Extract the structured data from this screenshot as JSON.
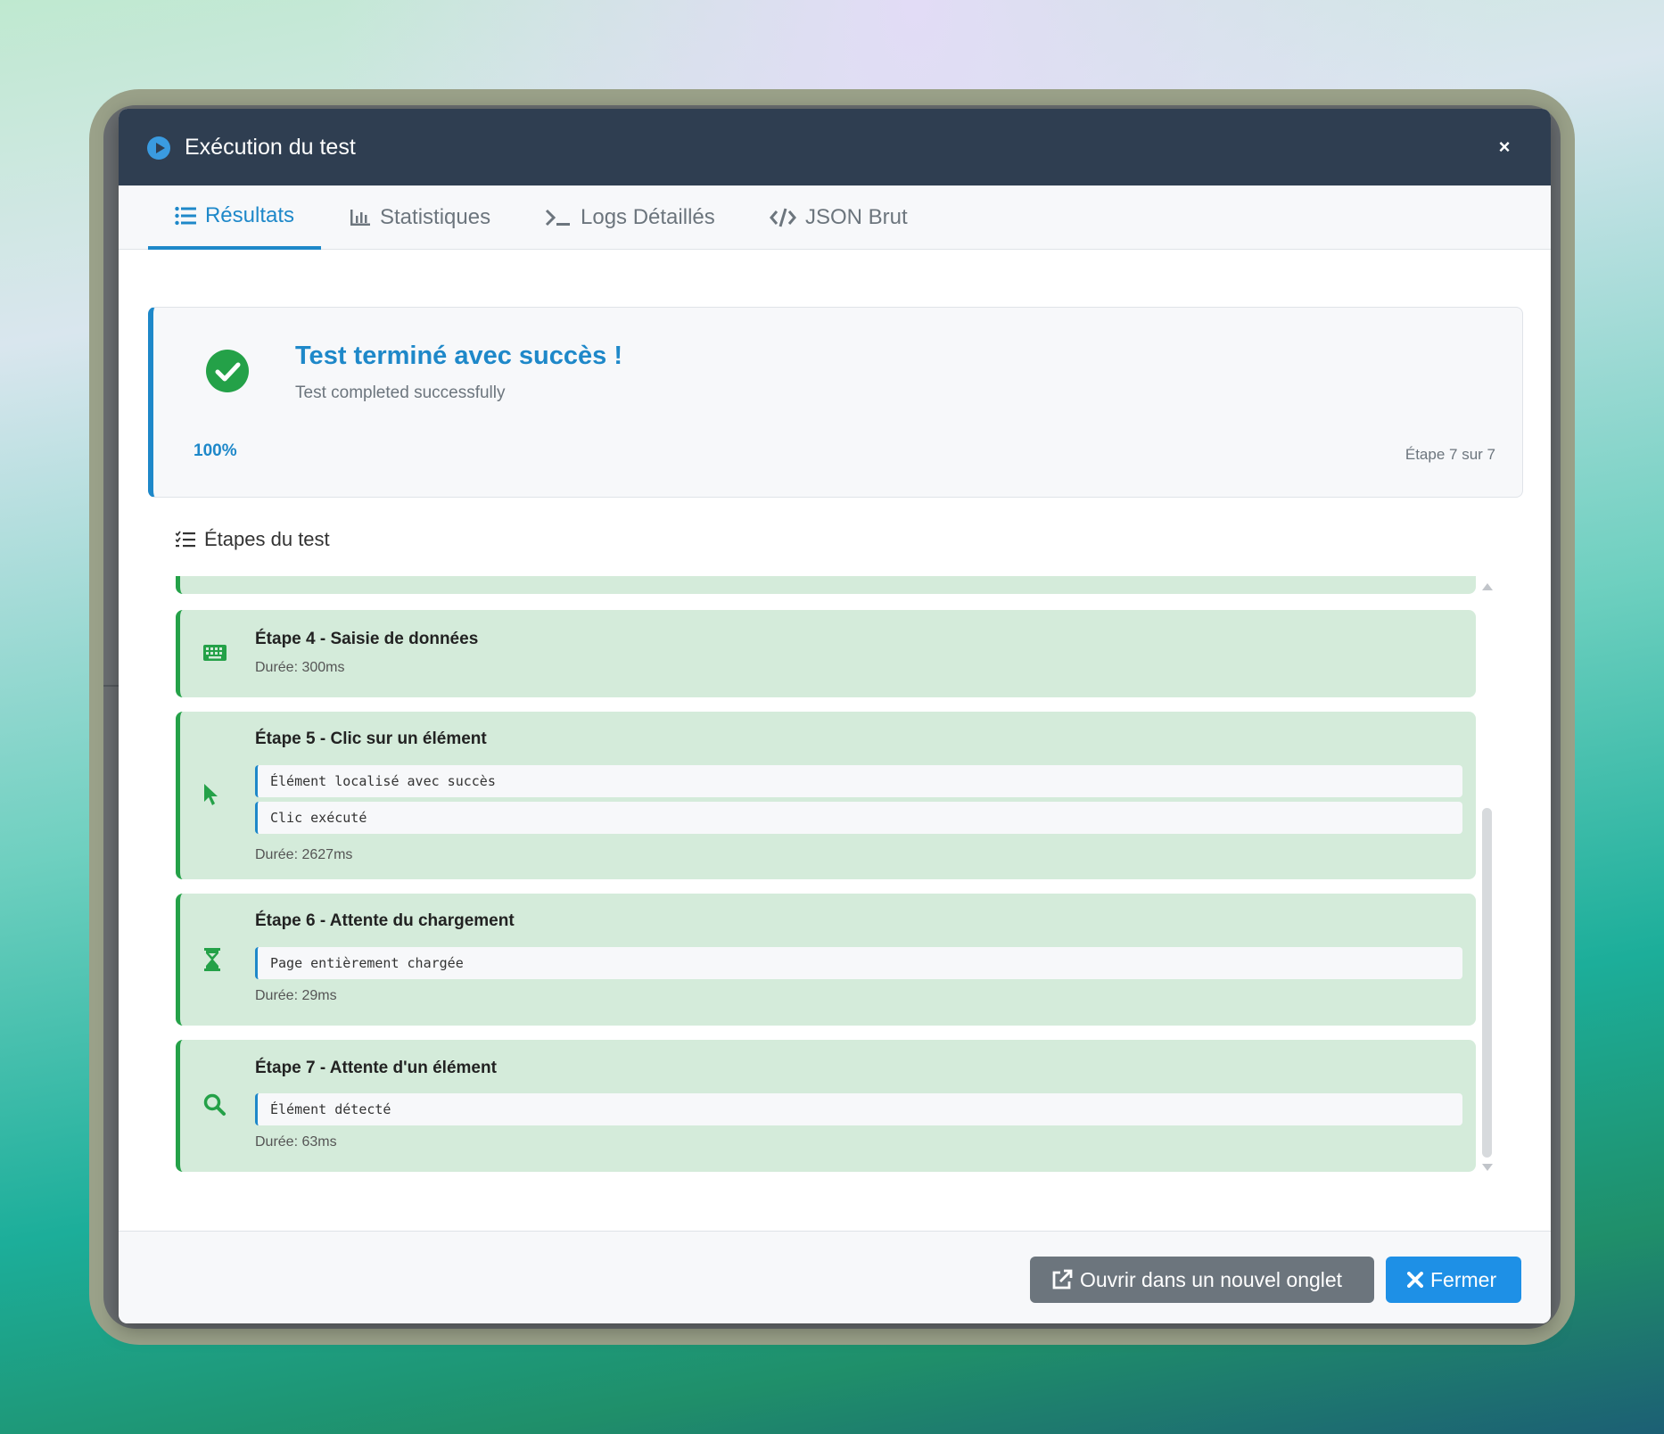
{
  "modal": {
    "title": "Exécution du test",
    "close_glyph": "×"
  },
  "tabs": [
    {
      "label": "Résultats",
      "icon": "list-icon",
      "active": true
    },
    {
      "label": "Statistiques",
      "icon": "bar-chart-icon",
      "active": false
    },
    {
      "label": "Logs Détaillés",
      "icon": "terminal-icon",
      "active": false
    },
    {
      "label": "JSON Brut",
      "icon": "code-icon",
      "active": false
    }
  ],
  "status": {
    "title": "Test terminé avec succès !",
    "subtitle": "Test completed successfully",
    "progress": "100%",
    "step_counter": "Étape 7 sur 7"
  },
  "steps_heading": "Étapes du test",
  "steps": [
    {
      "name": "Étape 4 - Saisie de données",
      "icon": "keyboard-icon",
      "logs": [],
      "duration": "Durée: 300ms"
    },
    {
      "name": "Étape 5 - Clic sur un élément",
      "icon": "cursor-icon",
      "logs": [
        "Élément localisé avec succès",
        "Clic exécuté"
      ],
      "duration": "Durée: 2627ms"
    },
    {
      "name": "Étape 6 - Attente du chargement",
      "icon": "hourglass-icon",
      "logs": [
        "Page entièrement chargée"
      ],
      "duration": "Durée: 29ms"
    },
    {
      "name": "Étape 7 - Attente d'un élément",
      "icon": "search-icon",
      "logs": [
        "Élément détecté"
      ],
      "duration": "Durée: 63ms"
    }
  ],
  "footer": {
    "open_label": "Ouvrir dans un nouvel onglet",
    "close_label": "Fermer"
  },
  "colors": {
    "header_bg": "#2f3e51",
    "accent": "#1e88c9",
    "success": "#24a148",
    "step_bg": "#d4ebda"
  }
}
